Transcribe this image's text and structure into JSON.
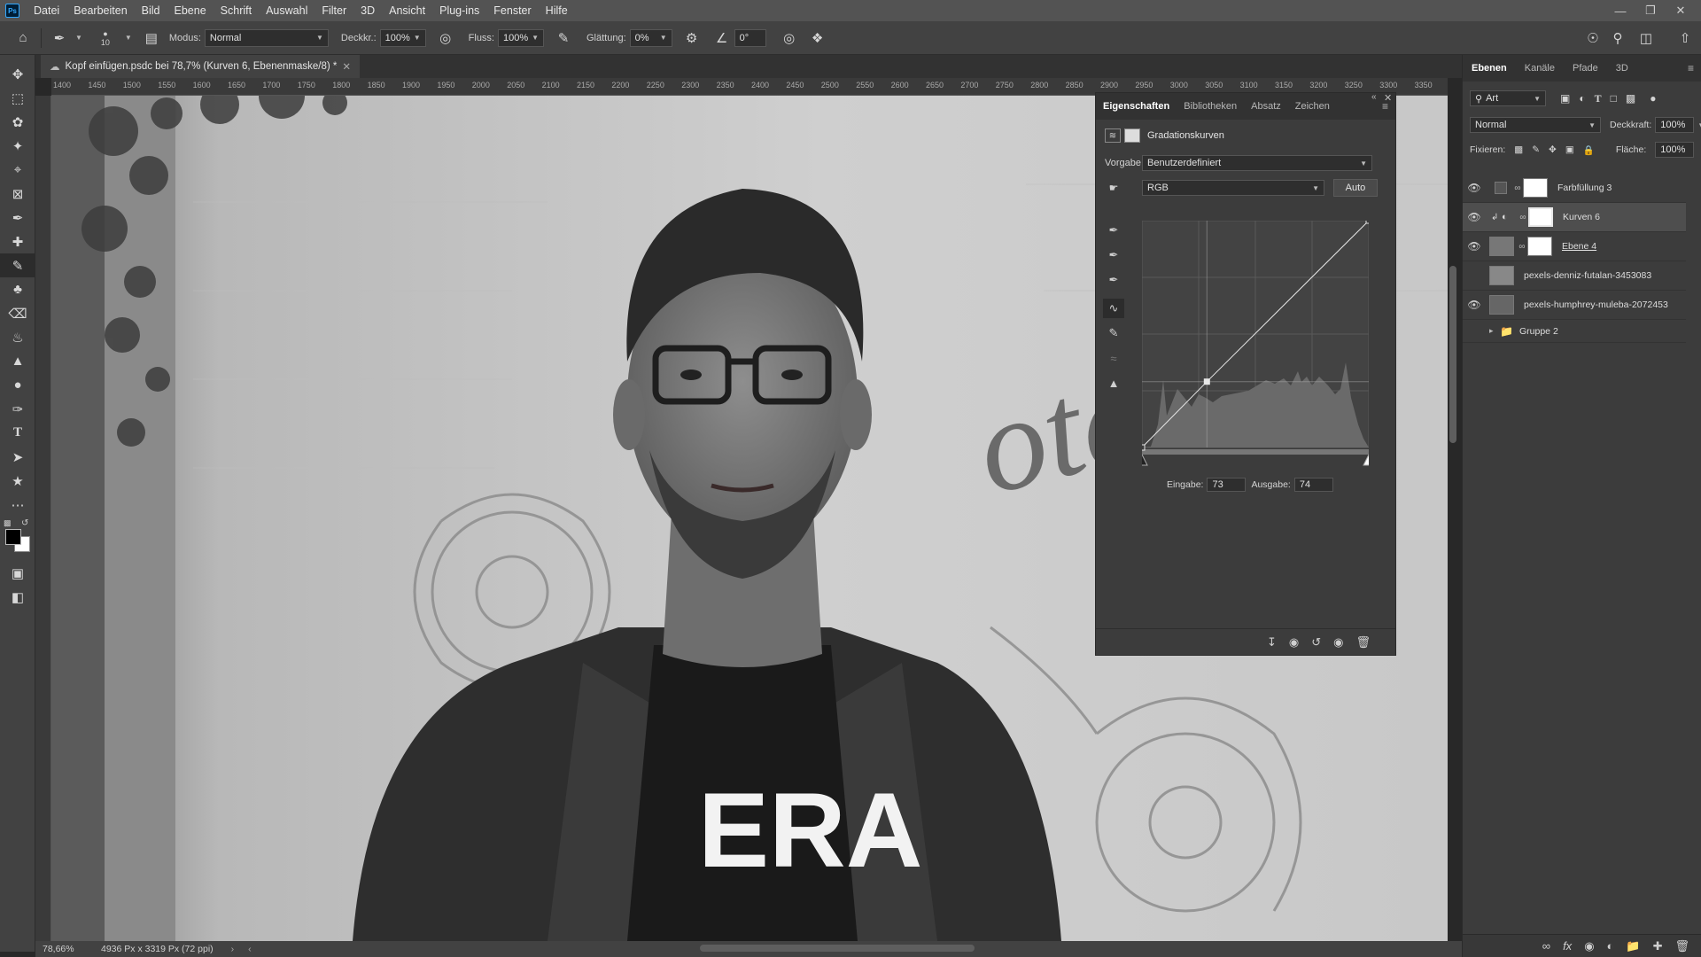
{
  "app": {
    "logo": "Ps"
  },
  "menu": {
    "items": [
      "Datei",
      "Bearbeiten",
      "Bild",
      "Ebene",
      "Schrift",
      "Auswahl",
      "Filter",
      "3D",
      "Ansicht",
      "Plug-ins",
      "Fenster",
      "Hilfe"
    ]
  },
  "options": {
    "brush_size": "10",
    "modus_label": "Modus:",
    "modus_value": "Normal",
    "deckkraft_label": "Deckkr.:",
    "deckkraft_value": "100%",
    "fluss_label": "Fluss:",
    "fluss_value": "100%",
    "glaettung_label": "Glättung:",
    "glaettung_value": "0%",
    "angle_value": "0°"
  },
  "document": {
    "tab_title": "Kopf einfügen.psdc bei 78,7% (Kurven 6, Ebenenmaske/8) *"
  },
  "ruler": {
    "ticks": [
      "1400",
      "1450",
      "1500",
      "1550",
      "1600",
      "1650",
      "1700",
      "1750",
      "1800",
      "1850",
      "1900",
      "1950",
      "2000",
      "2050",
      "2100",
      "2150",
      "2200",
      "2250",
      "2300",
      "2350",
      "2400",
      "2450",
      "2500",
      "2550",
      "2600",
      "2650",
      "2700",
      "2750",
      "2800",
      "2850",
      "2900",
      "2950",
      "3000",
      "3050",
      "3100",
      "3150",
      "3200",
      "3250",
      "3300",
      "3350"
    ]
  },
  "canvas": {
    "shirt_text": "ERA",
    "wall_text": "otan"
  },
  "status": {
    "zoom": "78,66%",
    "doc_info": "4936 Px x 3319 Px (72 ppi)"
  },
  "properties": {
    "tabs": [
      "Eigenschaften",
      "Bibliotheken",
      "Absatz",
      "Zeichen"
    ],
    "title": "Gradationskurven",
    "vorgabe_label": "Vorgabe:",
    "vorgabe_value": "Benutzerdefiniert",
    "channel": "RGB",
    "auto_label": "Auto",
    "eingabe_label": "Eingabe:",
    "eingabe_value": "73",
    "ausgabe_label": "Ausgabe:",
    "ausgabe_value": "74",
    "curve_point": {
      "input": 73,
      "output": 74
    }
  },
  "layers_panel": {
    "tabs": [
      "Ebenen",
      "Kanäle",
      "Pfade",
      "3D"
    ],
    "filter_label": "Art",
    "blend_mode": "Normal",
    "deckkraft_label": "Deckkraft:",
    "deckkraft_value": "100%",
    "fixieren_label": "Fixieren:",
    "flaeche_label": "Fläche:",
    "flaeche_value": "100%",
    "layers": [
      {
        "name": "Farbfüllung 3",
        "visible": true
      },
      {
        "name": "Kurven 6",
        "visible": true,
        "selected": true
      },
      {
        "name": "Ebene 4",
        "visible": true
      },
      {
        "name": "pexels-denniz-futalan-3453083",
        "visible": false
      },
      {
        "name": "pexels-humphrey-muleba-2072453",
        "visible": true
      },
      {
        "name": "Gruppe 2",
        "visible": false
      }
    ]
  },
  "colors": {
    "accent": "#31a8ff",
    "foreground": "#000000",
    "background": "#ffffff"
  }
}
